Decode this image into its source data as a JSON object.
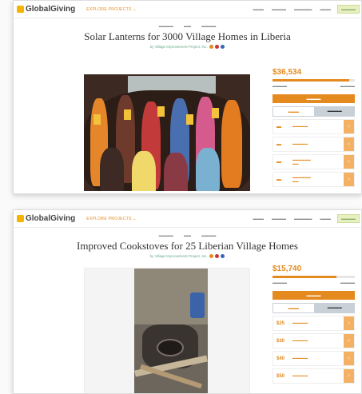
{
  "colors": {
    "accent": "#e58a1f",
    "brand": "#f4b400",
    "progress_bg": "#e6e6e6"
  },
  "nav": {
    "logo_text": "GlobalGiving",
    "explore": "EXPLORE PROJECTS",
    "explore_icon": "chevron-down-icon"
  },
  "page1": {
    "title": "Solar Lanterns for 3000 Village Homes in Liberia",
    "org": "by Village Improvement Project, Inc.",
    "amount": "$36,534",
    "progress": 0.93
  },
  "page2": {
    "title": "Improved Cookstoves for 25 Liberian Village Homes",
    "org": "by Village Improvement Project, Inc.",
    "amount": "$15,740",
    "progress": 0.78,
    "options": [
      {
        "amount": "$25"
      },
      {
        "amount": "$30"
      },
      {
        "amount": "$40"
      },
      {
        "amount": "$50"
      }
    ]
  }
}
